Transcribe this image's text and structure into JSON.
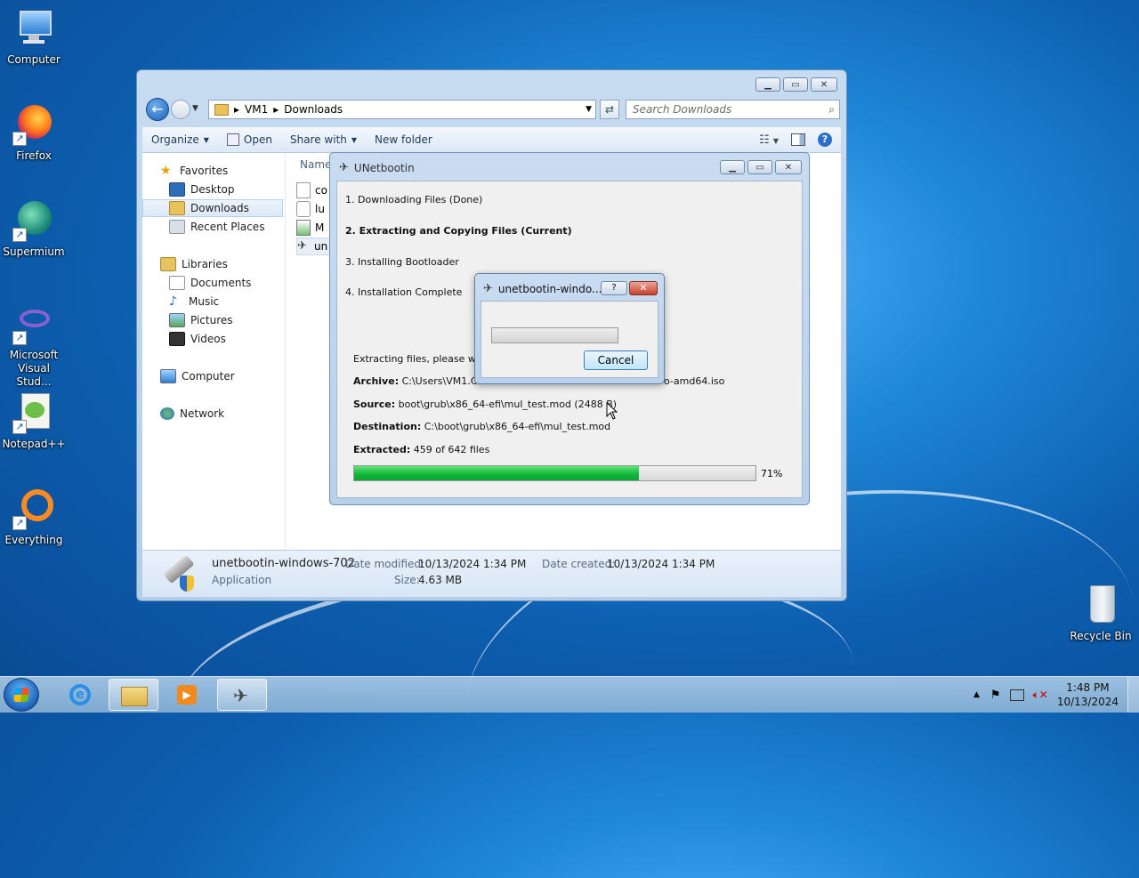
{
  "desktop": {
    "icons": [
      {
        "label": "Computer"
      },
      {
        "label": "Firefox"
      },
      {
        "label": "Supermium"
      },
      {
        "label": "Microsoft Visual Stud..."
      },
      {
        "label": "Notepad++"
      },
      {
        "label": "Everything"
      },
      {
        "label": "Recycle Bin"
      }
    ]
  },
  "explorer": {
    "breadcrumb": [
      "VM1",
      "Downloads"
    ],
    "search_placeholder": "Search Downloads",
    "toolbar": {
      "organize": "Organize",
      "open": "Open",
      "share_with": "Share with",
      "new_folder": "New folder"
    },
    "nav": {
      "favorites": "Favorites",
      "desktop": "Desktop",
      "downloads": "Downloads",
      "recent_places": "Recent Places",
      "libraries": "Libraries",
      "documents": "Documents",
      "music": "Music",
      "pictures": "Pictures",
      "videos": "Videos",
      "computer": "Computer",
      "network": "Network"
    },
    "column_name": "Name",
    "files": [
      {
        "name": "co"
      },
      {
        "name": "lu"
      },
      {
        "name": "M"
      },
      {
        "name": "un"
      }
    ],
    "details": {
      "file_name": "unetbootin-windows-702",
      "file_type": "Application",
      "date_modified_label": "Date modified:",
      "date_modified": "10/13/2024 1:34 PM",
      "date_created_label": "Date created:",
      "date_created": "10/13/2024 1:34 PM",
      "size_label": "Size:",
      "size": "4.63 MB"
    }
  },
  "unetbootin": {
    "title": "UNetbootin",
    "steps": [
      "1. Downloading Files (Done)",
      "2. Extracting and Copying Files (Current)",
      "3. Installing Bootloader",
      "4. Installation Complete"
    ],
    "status": "Extracting files, please wait...",
    "archive_label": "Archive:",
    "archive_value": "C:\\Users\\VM1.CO",
    "archive_tail": "o-amd64.iso",
    "source_label": "Source:",
    "source_value": "boot\\grub\\x86_64-efi\\mul_test.mod (2488 B)",
    "destination_label": "Destination:",
    "destination_value": "C:\\boot\\grub\\x86_64-efi\\mul_test.mod",
    "extracted_label": "Extracted:",
    "extracted_value": "459 of 642 files",
    "progress": 0.71,
    "progress_text": "71%"
  },
  "dialog": {
    "title": "unetbootin-windo...",
    "help_label": "?",
    "close_label": "✕",
    "cancel_label": "Cancel"
  },
  "taskbar": {
    "time": "1:48 PM",
    "date": "10/13/2024",
    "tray_arrow": "▲"
  }
}
